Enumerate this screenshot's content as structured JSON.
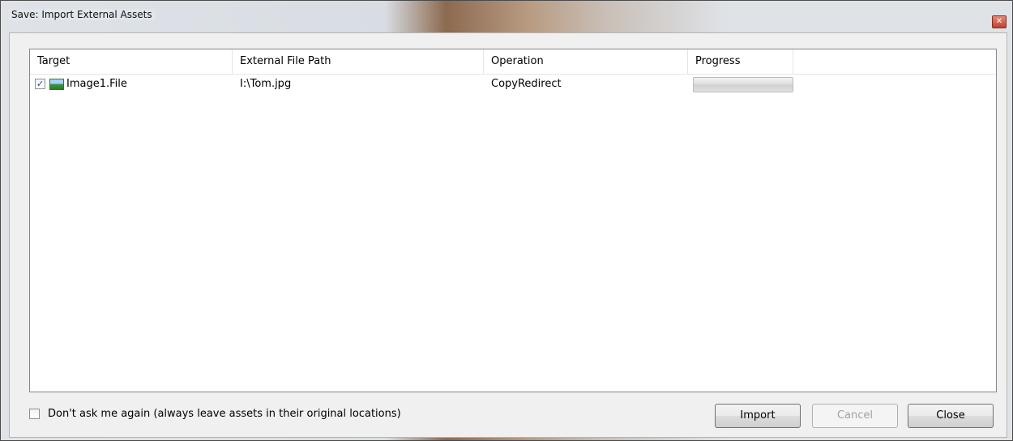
{
  "window": {
    "title": "Save: Import External Assets"
  },
  "columns": [
    "Target",
    "External File Path",
    "Operation",
    "Progress"
  ],
  "rows": [
    {
      "checked": true,
      "icon": "image-icon",
      "target": "Image1.File",
      "path": "I:\\Tom.jpg",
      "operation": "CopyRedirect",
      "progress": 0
    }
  ],
  "footer": {
    "dont_ask_label": "Don't ask me again (always leave assets in their original locations)",
    "dont_ask_checked": false,
    "import_label": "Import",
    "cancel_label": "Cancel",
    "close_label": "Close"
  },
  "colors": {
    "progress_fill": "#06b025",
    "close_button": "#c0412f"
  }
}
